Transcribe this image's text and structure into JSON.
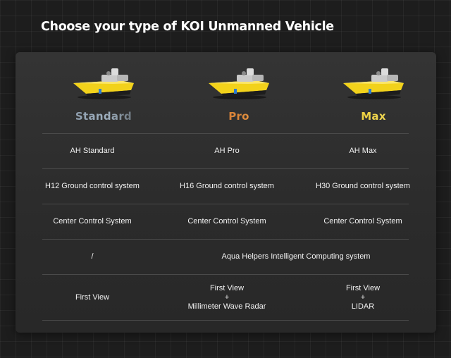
{
  "header": {
    "title": "Choose your type of KOI Unmanned Vehicle"
  },
  "models": [
    {
      "name": "Standard",
      "icon": "boat-vehicle-icon"
    },
    {
      "name": "Pro",
      "icon": "boat-vehicle-icon"
    },
    {
      "name": "Max",
      "icon": "boat-vehicle-icon"
    }
  ],
  "colors": {
    "standard": "#9fb0bf",
    "pro": "#e08a3a",
    "max": "#f0d43a",
    "boat_yellow": "#f2d21b"
  },
  "rows": {
    "hull": [
      "AH Standard",
      "AH Pro",
      "AH Max"
    ],
    "ground_control": [
      "H12 Ground control system",
      "H16 Ground control system",
      "H30 Ground control system"
    ],
    "center_control": [
      "Center Control System",
      "Center Control System",
      "Center Control System"
    ],
    "computing": {
      "standard": "/",
      "pro_max": "Aqua Helpers Intelligent Computing system"
    },
    "sensors": {
      "standard": "First View",
      "pro": [
        "First View",
        "+",
        "Millimeter Wave Radar"
      ],
      "max": [
        "First View",
        "+",
        "LIDAR"
      ]
    }
  }
}
